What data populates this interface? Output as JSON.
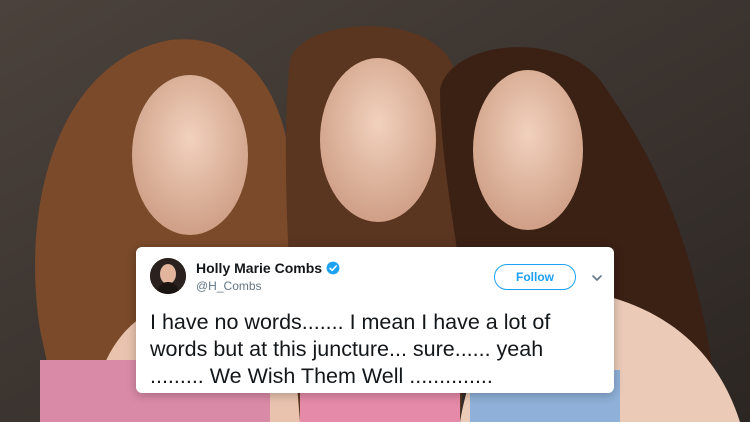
{
  "tweet": {
    "display_name": "Holly Marie Combs",
    "handle": "@H_Combs",
    "follow_label": "Follow",
    "text": "I have no words....... I mean I have a lot of\nwords but at this juncture... sure......  yeah\n......... We Wish Them Well  ..............",
    "verified": true
  },
  "icons": {
    "verified": "verified-badge-icon",
    "menu": "chevron-down-icon",
    "avatar": "profile-photo"
  },
  "colors": {
    "accent": "#1da1f2",
    "text": "#14171a",
    "secondary": "#657786"
  }
}
